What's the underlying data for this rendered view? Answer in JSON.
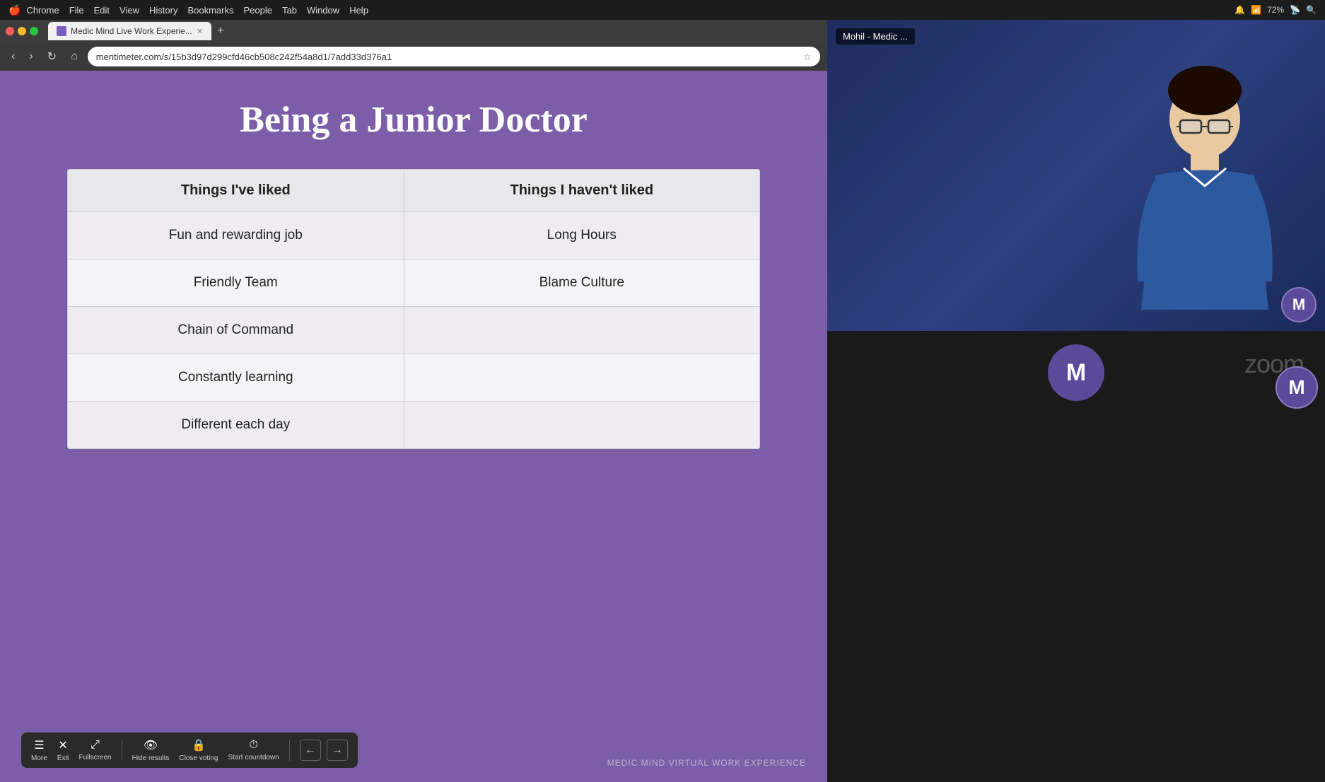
{
  "macbar": {
    "apple": "🍎",
    "app": "Chrome",
    "menus": [
      "Chrome",
      "File",
      "Edit",
      "View",
      "History",
      "Bookmarks",
      "People",
      "Tab",
      "Window",
      "Help"
    ]
  },
  "browser": {
    "tab_label": "Medic Mind Live Work Experie...",
    "url": "mentimeter.com/s/15b3d97d299cfd46cb508c242f54a8d1/7add33d376a1"
  },
  "slide": {
    "title": "Being a Junior Doctor",
    "col1_header": "Things I've liked",
    "col2_header": "Things I haven't liked",
    "rows": [
      {
        "liked": "Fun and rewarding job",
        "not_liked": "Long Hours"
      },
      {
        "liked": "Friendly Team",
        "not_liked": "Blame Culture"
      },
      {
        "liked": "Chain of Command",
        "not_liked": ""
      },
      {
        "liked": "Constantly learning",
        "not_liked": ""
      },
      {
        "liked": "Different each day",
        "not_liked": ""
      }
    ]
  },
  "toolbar": {
    "more": "More",
    "exit": "Exit",
    "fullscreen": "Fullscreen",
    "hide_results": "Hide results",
    "close_voting": "Close voting",
    "start_countdown": "Start countdown"
  },
  "branding": {
    "text": "MEDIC MIND VIRTUAL WORK EXPERIENCE"
  },
  "zoom": {
    "participant_name": "Mohil - Medic ...",
    "avatar_letter": "M"
  }
}
